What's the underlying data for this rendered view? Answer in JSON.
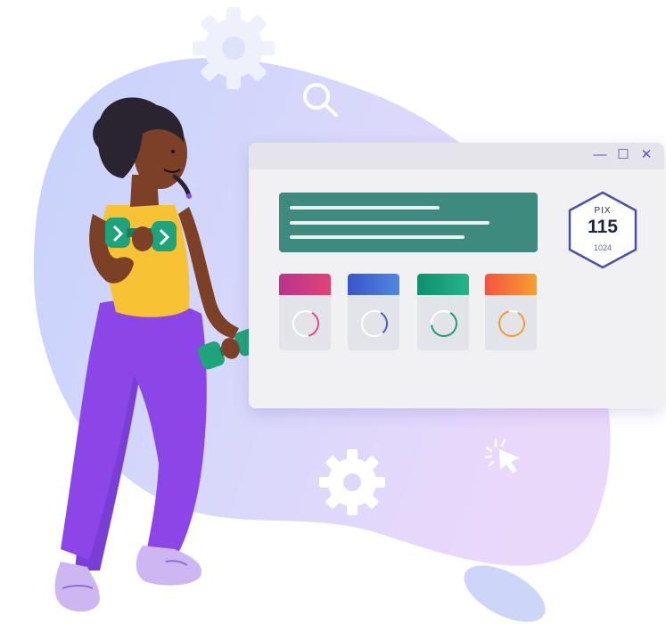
{
  "window": {
    "controls": [
      {
        "icon": "minimize-icon",
        "glyph": "—"
      },
      {
        "icon": "maximize-icon",
        "glyph": "☐"
      },
      {
        "icon": "close-icon",
        "glyph": "✕"
      }
    ]
  },
  "badge": {
    "label": "PIX",
    "value": "115",
    "total": "1024"
  },
  "cards": [
    {
      "color_top": "#b8348c",
      "color_bottom": "#e14377",
      "ring_color": "#e64682",
      "progress": 0.38
    },
    {
      "color_top": "#3a55c8",
      "color_bottom": "#4f88e0",
      "ring_color": "#3f5ed0",
      "progress": 0.3
    },
    {
      "color_top": "#0f8f6f",
      "color_bottom": "#25b58a",
      "ring_color": "#1d9b79",
      "progress": 0.65
    },
    {
      "color_top": "#f3533f",
      "color_bottom": "#f7a02f",
      "ring_color": "#f39a2f",
      "progress": 0.88
    }
  ],
  "colors": {
    "blob_left": "#c9d3fb",
    "blob_right": "#e6d7fb",
    "accent": "#5b4fd0",
    "banner": "#3e8a7f"
  }
}
